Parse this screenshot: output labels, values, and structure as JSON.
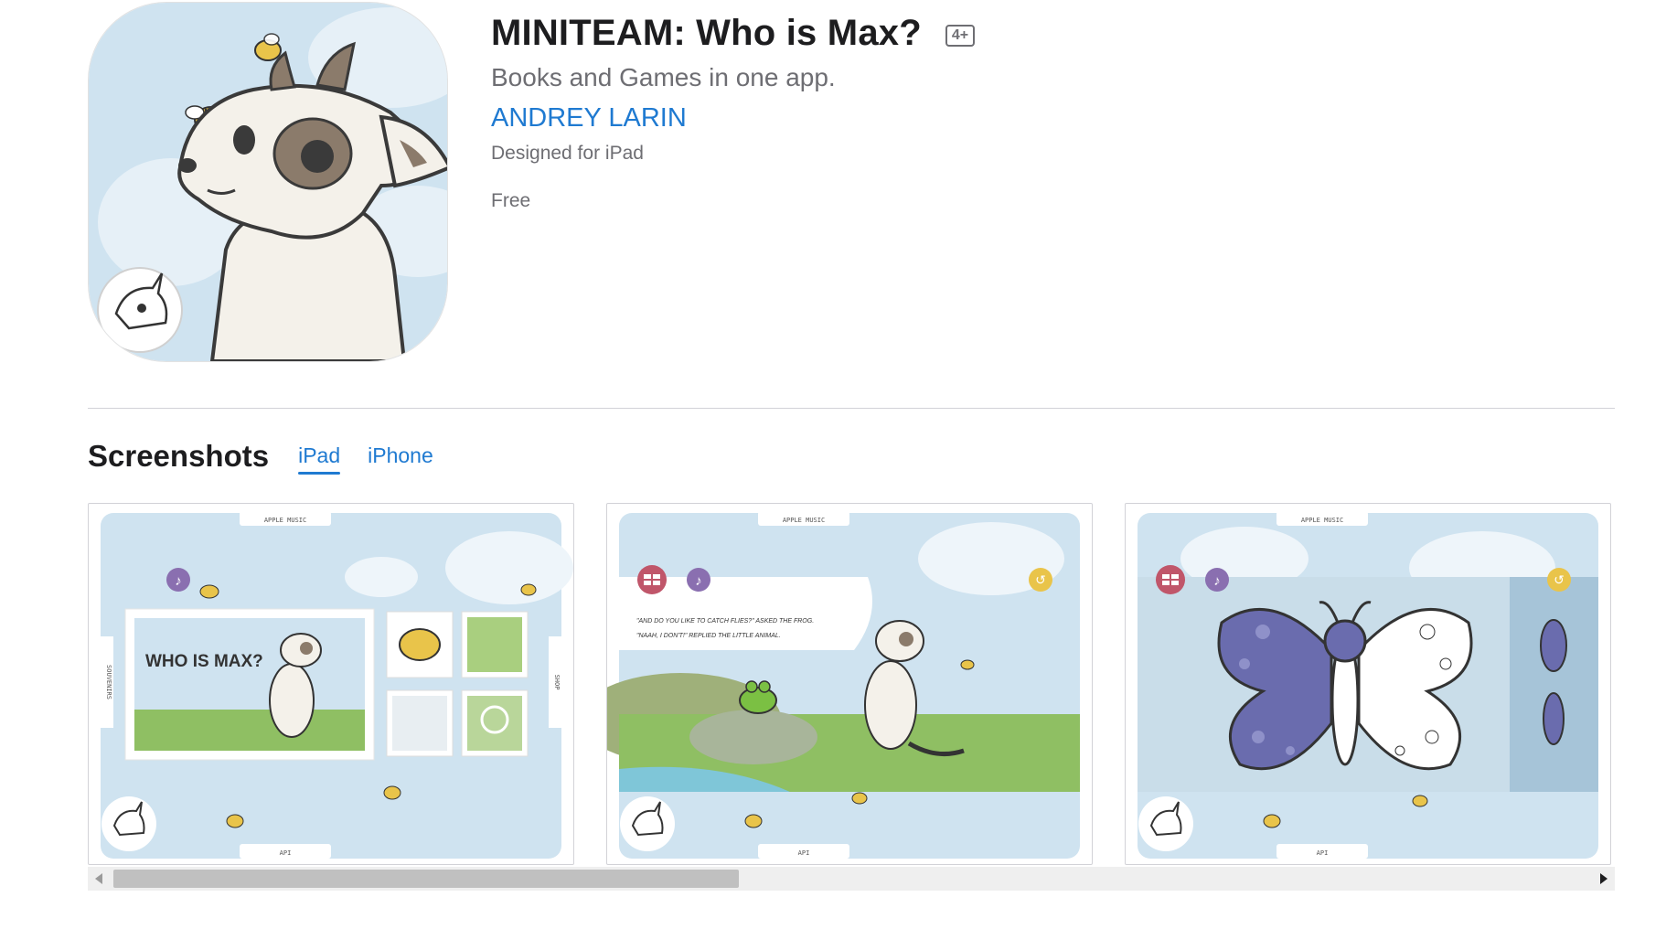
{
  "app": {
    "title": "MINITEAM: Who is Max?",
    "age_rating": "4+",
    "subtitle": "Books and Games in one app.",
    "developer": "ANDREY LARIN",
    "designed_for": "Designed for iPad",
    "price": "Free"
  },
  "screenshots": {
    "heading": "Screenshots",
    "tabs": [
      {
        "label": "iPad",
        "active": true
      },
      {
        "label": "iPhone",
        "active": false
      }
    ],
    "items": [
      {
        "tab_top": "APPLE MUSIC",
        "tab_bottom": "API",
        "side_left": "SOUVENIRS",
        "side_right": "SHOP",
        "cover_text": "WHO IS MAX?"
      },
      {
        "tab_top": "APPLE MUSIC",
        "tab_bottom": "API",
        "story_line1": "\"AND DO YOU LIKE TO CATCH FLIES?\" ASKED THE FROG.",
        "story_line2": "\"NAAH, I DON'T!\" REPLIED THE LITTLE ANIMAL."
      },
      {
        "tab_top": "APPLE MUSIC",
        "tab_bottom": "API"
      }
    ]
  },
  "colors": {
    "link_blue": "#1f7ad1",
    "sky": "#cfe3f0",
    "butterfly_purple": "#6a6cae"
  },
  "icons": [
    "bee-icon",
    "unicorn-logo-icon",
    "music-note-icon",
    "grid-menu-icon",
    "back-arrow-icon"
  ]
}
